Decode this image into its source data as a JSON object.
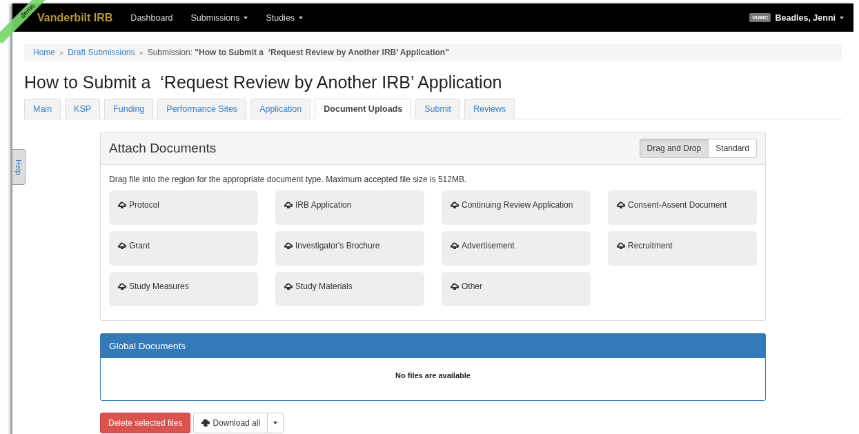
{
  "navbar": {
    "brand": "Vanderbilt IRB",
    "ribbon": "demo",
    "menu": [
      {
        "label": "Dashboard",
        "dropdown": false
      },
      {
        "label": "Submissions",
        "dropdown": true
      },
      {
        "label": "Studies",
        "dropdown": true
      }
    ],
    "user": {
      "badge": "VUMC",
      "name": "Beadles, Jenni"
    }
  },
  "help_tab": "Help",
  "breadcrumb": {
    "links": [
      "Home",
      "Draft Submissions"
    ],
    "separator": "»",
    "current_label": "Submission:",
    "current_title": "\"How to Submit a  ‘Request Review by Another IRB’ Application\""
  },
  "page_title": "How to Submit a  ‘Request Review by Another IRB’ Application",
  "tabs": [
    {
      "label": "Main",
      "selected": false
    },
    {
      "label": "KSP",
      "selected": false
    },
    {
      "label": "Funding",
      "selected": false
    },
    {
      "label": "Performance Sites",
      "selected": false
    },
    {
      "label": "Application",
      "selected": false
    },
    {
      "label": "Document Uploads",
      "selected": true
    },
    {
      "label": "Submit",
      "selected": false
    },
    {
      "label": "Reviews",
      "selected": false
    }
  ],
  "attach_panel": {
    "title": "Attach Documents",
    "modes": [
      {
        "label": "Drag and Drop",
        "selected": true
      },
      {
        "label": "Standard",
        "selected": false
      }
    ],
    "instructions": "Drag file into the region for the appropriate document type. Maximum accepted file size is 512MB.",
    "drop_zones": [
      "Protocol",
      "IRB Application",
      "Continuing Review Application",
      "Consent-Assent Document",
      "Grant",
      "Investigator's Brochure",
      "Advertisement",
      "Recruitment",
      "Study Measures",
      "Study Materials",
      "Other"
    ]
  },
  "global_panel": {
    "title": "Global Documents",
    "empty_message": "No files are available"
  },
  "actions": {
    "delete": "Delete selected files",
    "download": "Download all"
  }
}
